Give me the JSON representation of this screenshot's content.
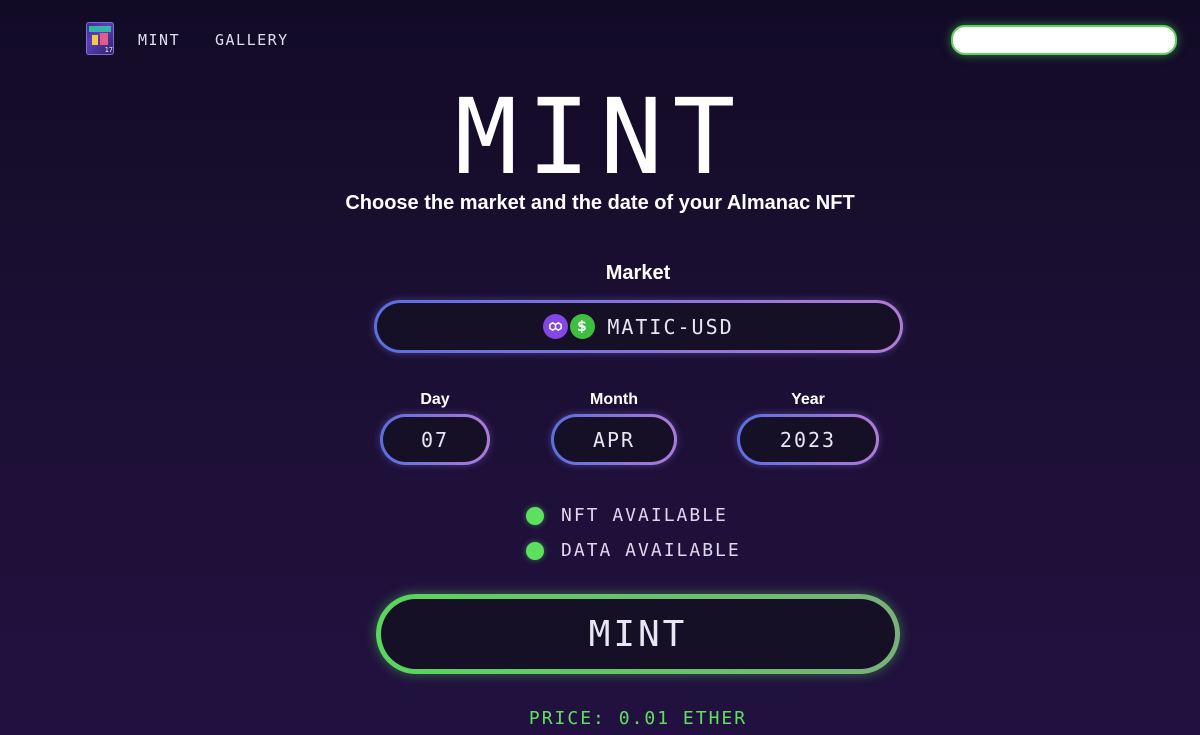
{
  "header": {
    "nav": [
      {
        "label": "MINT"
      },
      {
        "label": "GALLERY"
      }
    ],
    "logo_number": "17"
  },
  "main": {
    "title": "MINT",
    "subtitle": "Choose the market and the date of your Almanac NFT",
    "market": {
      "label": "Market",
      "value": "MATIC-USD",
      "icons": [
        "polygon-icon",
        "dollar-icon"
      ],
      "usd_symbol": "$"
    },
    "date": {
      "day_label": "Day",
      "day_value": "07",
      "month_label": "Month",
      "month_value": "APR",
      "year_label": "Year",
      "year_value": "2023"
    },
    "status": [
      {
        "label": "NFT AVAILABLE",
        "color": "#5ee05f"
      },
      {
        "label": "DATA AVAILABLE",
        "color": "#5ee05f"
      }
    ],
    "mint_button": "MINT",
    "price": "PRICE: 0.01 ETHER"
  },
  "colors": {
    "background": "#1b0f33",
    "accent_green": "#58d65d",
    "gradient_start": "#5a6fe0",
    "gradient_end": "#b07ad6"
  }
}
